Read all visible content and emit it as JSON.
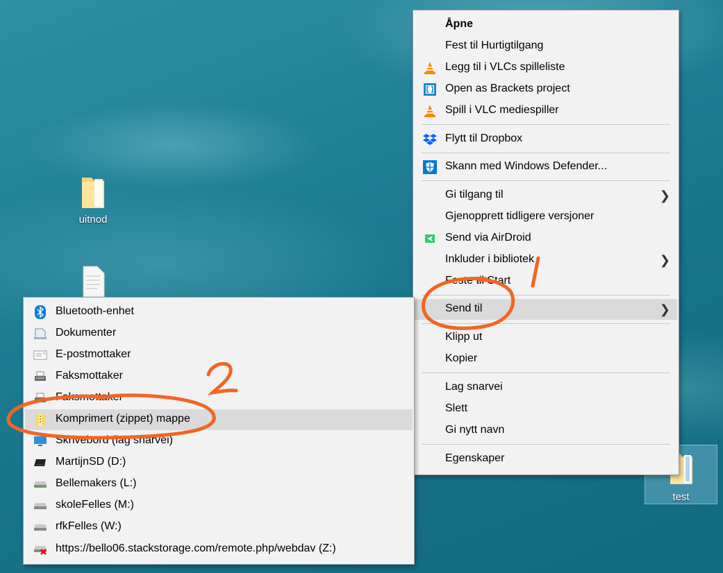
{
  "desktop": {
    "icons": [
      {
        "label": "uitnod"
      },
      {
        "label": "test"
      }
    ]
  },
  "context_menu": {
    "items": [
      {
        "label": "Åpne"
      },
      {
        "label": "Fest til Hurtigtilgang"
      },
      {
        "label": "Legg til i VLCs spilleliste"
      },
      {
        "label": "Open as Brackets project"
      },
      {
        "label": "Spill i VLC mediespiller"
      },
      {
        "label": "Flytt til Dropbox"
      },
      {
        "label": "Skann med Windows Defender..."
      },
      {
        "label": "Gi tilgang til"
      },
      {
        "label": "Gjenopprett tidligere versjoner"
      },
      {
        "label": "Send via AirDroid"
      },
      {
        "label": "Inkluder i bibliotek"
      },
      {
        "label": "Feste til Start"
      },
      {
        "label": "Send til"
      },
      {
        "label": "Klipp ut"
      },
      {
        "label": "Kopier"
      },
      {
        "label": "Lag snarvei"
      },
      {
        "label": "Slett"
      },
      {
        "label": "Gi nytt navn"
      },
      {
        "label": "Egenskaper"
      }
    ]
  },
  "send_to_menu": {
    "items": [
      {
        "label": "Bluetooth-enhet"
      },
      {
        "label": "Dokumenter"
      },
      {
        "label": "E-postmottaker"
      },
      {
        "label": "Faksmottaker"
      },
      {
        "label": "Faksmottaker"
      },
      {
        "label": "Komprimert (zippet) mappe"
      },
      {
        "label": "Skrivebord (lag snarvei)"
      },
      {
        "label": "MartijnSD (D:)"
      },
      {
        "label": "Bellemakers (L:)"
      },
      {
        "label": "skoleFelles (M:)"
      },
      {
        "label": "rfkFelles (W:)"
      },
      {
        "label": "https://bello06.stackstorage.com/remote.php/webdav (Z:)"
      }
    ]
  },
  "annotations": {
    "step1": "1",
    "step2": "2"
  },
  "colors": {
    "menu_bg": "#f2f2f2",
    "highlight": "#dadada",
    "annotation": "#f26522",
    "vlc_orange": "#f08c00",
    "dropbox_blue": "#0061fe",
    "defender_blue": "#0078d7"
  }
}
